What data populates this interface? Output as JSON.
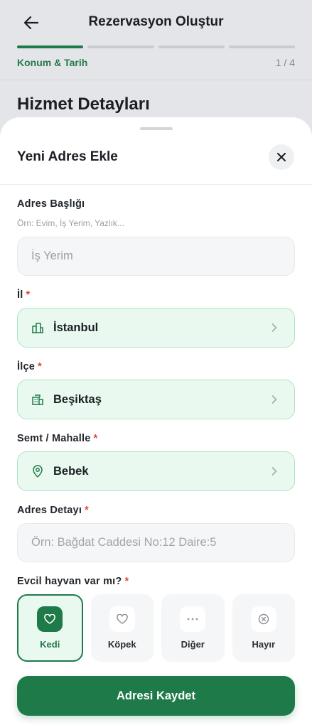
{
  "header": {
    "title": "Rezervasyon Oluştur",
    "step_label": "Konum & Tarih",
    "step_count": "1 / 4",
    "progress_segments": 4,
    "progress_active": 1
  },
  "section": {
    "title": "Hizmet Detayları"
  },
  "sheet": {
    "title": "Yeni Adres Ekle",
    "fields": {
      "address_title": {
        "label": "Adres Başlığı",
        "hint": "Örn: Evim, İş Yerim, Yazlık...",
        "value": "İş Yerim"
      },
      "province": {
        "label": "İl",
        "required_mark": "*",
        "value": "İstanbul",
        "icon": "city-icon"
      },
      "district": {
        "label": "İlçe",
        "required_mark": "*",
        "value": "Beşiktaş",
        "icon": "building-icon"
      },
      "neighborhood": {
        "label": "Semt / Mahalle",
        "required_mark": "*",
        "value": "Bebek",
        "icon": "location-pin-icon"
      },
      "address_detail": {
        "label": "Adres Detayı",
        "required_mark": "*",
        "placeholder": "Örn: Bağdat Caddesi No:12 Daire:5"
      }
    },
    "pets": {
      "label": "Evcil hayvan var mı?",
      "required_mark": "*",
      "options": [
        {
          "label": "Kedi",
          "icon": "heart-icon",
          "selected": true
        },
        {
          "label": "Köpek",
          "icon": "heart-icon",
          "selected": false
        },
        {
          "label": "Diğer",
          "icon": "more-icon",
          "selected": false
        },
        {
          "label": "Hayır",
          "icon": "x-circle-icon",
          "selected": false
        }
      ]
    },
    "save_label": "Adresi Kaydet"
  },
  "colors": {
    "primary": "#1f7a4a",
    "select_bg": "#e9f9ef",
    "select_border": "#aee5c4",
    "required": "#e0453a"
  }
}
